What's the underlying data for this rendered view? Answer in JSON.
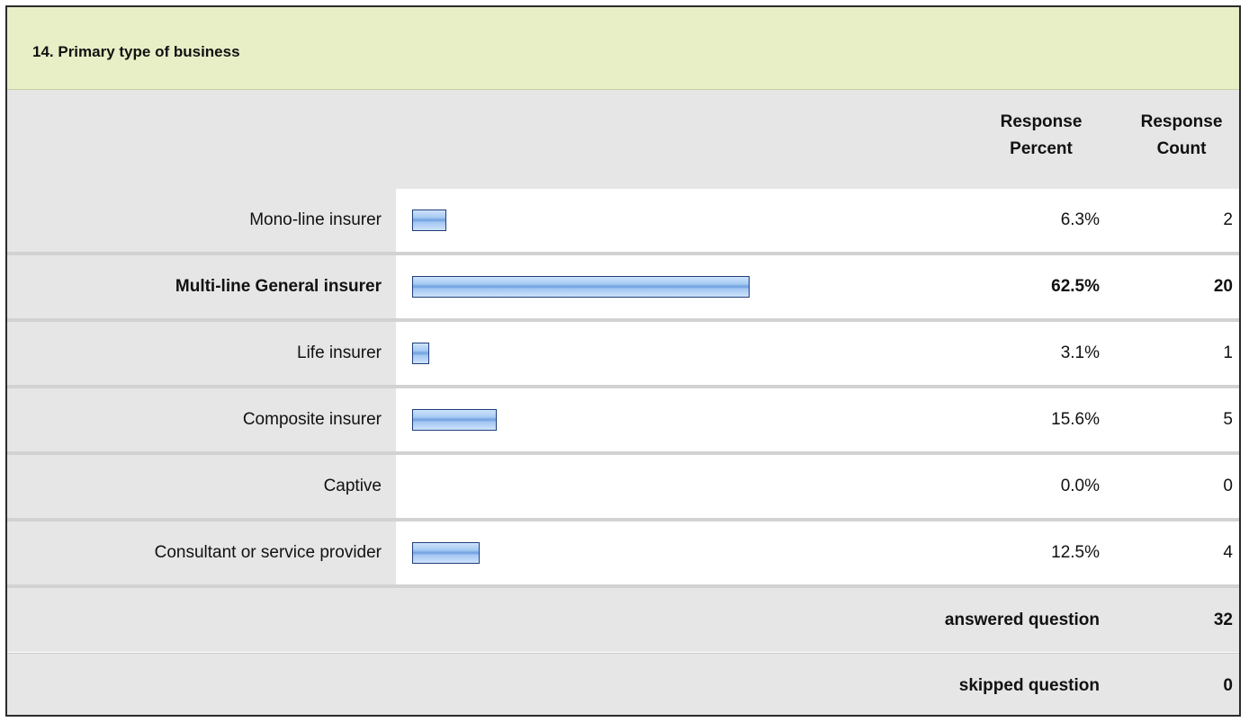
{
  "title": "14. Primary type of business",
  "headers": {
    "percent": [
      "Response",
      "Percent"
    ],
    "count": [
      "Response",
      "Count"
    ]
  },
  "colors": {
    "title_bg": "#e8eec6",
    "bar_fill": "#8fb8ec",
    "bar_border": "#1f3f7a",
    "row_label_bg": "#e6e6e6"
  },
  "chart_data": {
    "type": "bar",
    "orientation": "horizontal",
    "title": "14. Primary type of business",
    "categories": [
      "Mono-line insurer",
      "Multi-line General insurer",
      "Life insurer",
      "Composite insurer",
      "Captive",
      "Consultant or service provider"
    ],
    "values": [
      6.3,
      62.5,
      3.1,
      15.6,
      0.0,
      12.5
    ],
    "counts": [
      2,
      20,
      1,
      5,
      0,
      4
    ],
    "value_labels": [
      "6.3%",
      "62.5%",
      "3.1%",
      "15.6%",
      "0.0%",
      "12.5%"
    ],
    "highlighted_category": "Multi-line General insurer",
    "xlim": [
      0,
      100
    ]
  },
  "rows": [
    {
      "label": "Mono-line insurer",
      "percent": "6.3%",
      "count": "2"
    },
    {
      "label": "Multi-line General insurer",
      "percent": "62.5%",
      "count": "20"
    },
    {
      "label": "Life insurer",
      "percent": "3.1%",
      "count": "1"
    },
    {
      "label": "Composite insurer",
      "percent": "15.6%",
      "count": "5"
    },
    {
      "label": "Captive",
      "percent": "0.0%",
      "count": "0"
    },
    {
      "label": "Consultant or service provider",
      "percent": "12.5%",
      "count": "4"
    }
  ],
  "summary": {
    "answered_label": "answered question",
    "answered_value": "32",
    "skipped_label": "skipped question",
    "skipped_value": "0"
  }
}
